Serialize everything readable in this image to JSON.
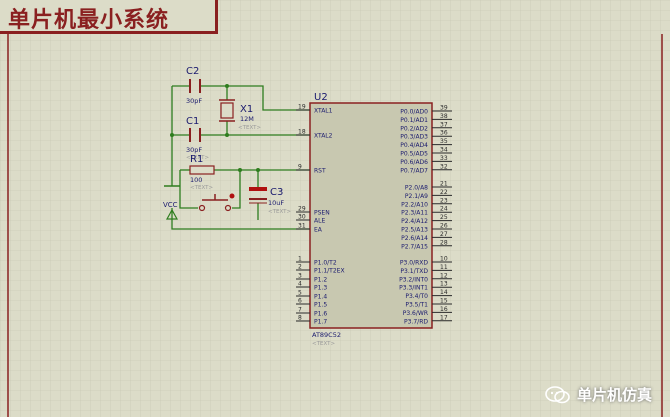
{
  "title": "单片机最小系统",
  "watermark": "单片机仿真",
  "chip": {
    "ref": "U2",
    "part": "AT89C52",
    "text_placeholder": "<TEXT>",
    "left_pins": [
      {
        "num": "19",
        "label": "XTAL1"
      },
      {
        "num": "18",
        "label": "XTAL2"
      },
      {
        "num": "9",
        "label": "RST"
      },
      {
        "num": "29",
        "label": "PSEN"
      },
      {
        "num": "30",
        "label": "ALE"
      },
      {
        "num": "31",
        "label": "EA"
      },
      {
        "num": "1",
        "label": "P1.0/T2"
      },
      {
        "num": "2",
        "label": "P1.1/T2EX"
      },
      {
        "num": "3",
        "label": "P1.2"
      },
      {
        "num": "4",
        "label": "P1.3"
      },
      {
        "num": "5",
        "label": "P1.4"
      },
      {
        "num": "6",
        "label": "P1.5"
      },
      {
        "num": "7",
        "label": "P1.6"
      },
      {
        "num": "8",
        "label": "P1.7"
      }
    ],
    "right_pins": [
      {
        "num": "39",
        "label": "P0.0/AD0"
      },
      {
        "num": "38",
        "label": "P0.1/AD1"
      },
      {
        "num": "37",
        "label": "P0.2/AD2"
      },
      {
        "num": "36",
        "label": "P0.3/AD3"
      },
      {
        "num": "35",
        "label": "P0.4/AD4"
      },
      {
        "num": "34",
        "label": "P0.5/AD5"
      },
      {
        "num": "33",
        "label": "P0.6/AD6"
      },
      {
        "num": "32",
        "label": "P0.7/AD7"
      },
      {
        "num": "21",
        "label": "P2.0/A8"
      },
      {
        "num": "22",
        "label": "P2.1/A9"
      },
      {
        "num": "23",
        "label": "P2.2/A10"
      },
      {
        "num": "24",
        "label": "P2.3/A11"
      },
      {
        "num": "25",
        "label": "P2.4/A12"
      },
      {
        "num": "26",
        "label": "P2.5/A13"
      },
      {
        "num": "27",
        "label": "P2.6/A14"
      },
      {
        "num": "28",
        "label": "P2.7/A15"
      },
      {
        "num": "10",
        "label": "P3.0/RXD"
      },
      {
        "num": "11",
        "label": "P3.1/TXD"
      },
      {
        "num": "12",
        "label": "P3.2/INT0"
      },
      {
        "num": "13",
        "label": "P3.3/INT1"
      },
      {
        "num": "14",
        "label": "P3.4/T0"
      },
      {
        "num": "15",
        "label": "P3.5/T1"
      },
      {
        "num": "16",
        "label": "P3.6/WR"
      },
      {
        "num": "17",
        "label": "P3.7/RD"
      }
    ]
  },
  "components": {
    "c2": {
      "ref": "C2",
      "value": "30pF"
    },
    "c1": {
      "ref": "C1",
      "value": "30pF"
    },
    "x1": {
      "ref": "X1",
      "value": "12M"
    },
    "r1": {
      "ref": "R1",
      "value": "100"
    },
    "c3": {
      "ref": "C3",
      "value": "10uF"
    },
    "vcc": {
      "label": "VCC"
    },
    "text_placeholder": "<TEXT>"
  },
  "colors": {
    "wire": "#2e7d1e",
    "outline": "#8a2020",
    "chip_fill": "#c8c8b0",
    "label": "#1a1a6e",
    "pin_num": "#2a2a2a",
    "grid": "#c4c4b0",
    "placeholder": "#9a9a9a"
  }
}
